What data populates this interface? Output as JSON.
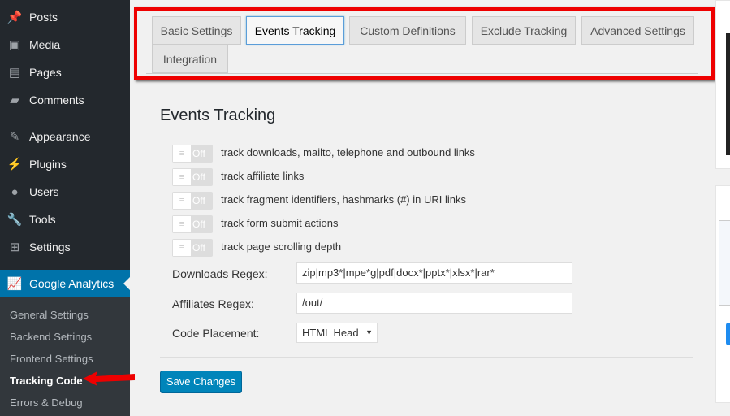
{
  "sidebar": {
    "items": [
      {
        "label": "Posts",
        "icon": "pin-icon"
      },
      {
        "label": "Media",
        "icon": "media-icon"
      },
      {
        "label": "Pages",
        "icon": "pages-icon"
      },
      {
        "label": "Comments",
        "icon": "comment-icon"
      },
      {
        "label": "Appearance",
        "icon": "brush-icon"
      },
      {
        "label": "Plugins",
        "icon": "plugin-icon"
      },
      {
        "label": "Users",
        "icon": "user-icon"
      },
      {
        "label": "Tools",
        "icon": "wrench-icon"
      },
      {
        "label": "Settings",
        "icon": "settings-icon"
      }
    ],
    "active": {
      "label": "Google Analytics",
      "icon": "chart-icon"
    },
    "submenu": [
      "General Settings",
      "Backend Settings",
      "Frontend Settings",
      "Tracking Code",
      "Errors & Debug"
    ],
    "current_submenu": "Tracking Code"
  },
  "tabs": [
    "Basic Settings",
    "Events Tracking",
    "Custom Definitions",
    "Exclude Tracking",
    "Advanced Settings",
    "Integration"
  ],
  "active_tab": "Events Tracking",
  "section": {
    "title": "Events Tracking",
    "toggles": [
      {
        "label": "track downloads, mailto, telephone and outbound links",
        "state": "Off"
      },
      {
        "label": "track affiliate links",
        "state": "Off"
      },
      {
        "label": "track fragment identifiers, hashmarks (#) in URI links",
        "state": "Off"
      },
      {
        "label": "track form submit actions",
        "state": "Off"
      },
      {
        "label": "track page scrolling depth",
        "state": "Off"
      }
    ],
    "fields": {
      "downloads_label": "Downloads Regex:",
      "downloads_value": "zip|mp3*|mpe*g|pdf|docx*|pptx*|xlsx*|rar*",
      "affiliates_label": "Affiliates Regex:",
      "affiliates_value": "/out/",
      "placement_label": "Code Placement:",
      "placement_value": "HTML Head"
    },
    "save_label": "Save Changes"
  },
  "colors": {
    "accent": "#0073aa",
    "highlight": "#ee0000",
    "button": "#0085ba"
  }
}
